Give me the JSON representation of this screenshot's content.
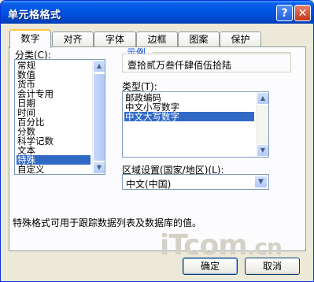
{
  "window": {
    "title": "单元格格式",
    "help_glyph": "?",
    "close_glyph": "✕"
  },
  "tabs": [
    {
      "label": "数字",
      "active": true
    },
    {
      "label": "对齐",
      "active": false
    },
    {
      "label": "字体",
      "active": false
    },
    {
      "label": "边框",
      "active": false
    },
    {
      "label": "图案",
      "active": false
    },
    {
      "label": "保护",
      "active": false
    }
  ],
  "category": {
    "label": "分类(C):",
    "items": [
      "常规",
      "数值",
      "货币",
      "会计专用",
      "日期",
      "时间",
      "百分比",
      "分数",
      "科学记数",
      "文本",
      "特殊",
      "自定义"
    ],
    "selected": "特殊"
  },
  "sample": {
    "label": "示例",
    "value": "壹拾贰万叁仟肆佰伍拾陆"
  },
  "type": {
    "label": "类型(T):",
    "items": [
      "邮政编码",
      "中文小写数字",
      "中文大写数字"
    ],
    "selected": "中文大写数字"
  },
  "locale": {
    "label": "区域设置(国家/地区)(L):",
    "value": "中文(中国)"
  },
  "description": "特殊格式可用于跟踪数据列表及数据库的值。",
  "buttons": {
    "ok": "确定",
    "cancel": "取消"
  },
  "watermark": {
    "text": "iTcom",
    "suffix": ".cn"
  },
  "colors": {
    "titlebar": "#0054e3",
    "selection": "#316ac5",
    "dialog_bg": "#ece9d8",
    "active_tab_accent": "#ffc83c"
  }
}
